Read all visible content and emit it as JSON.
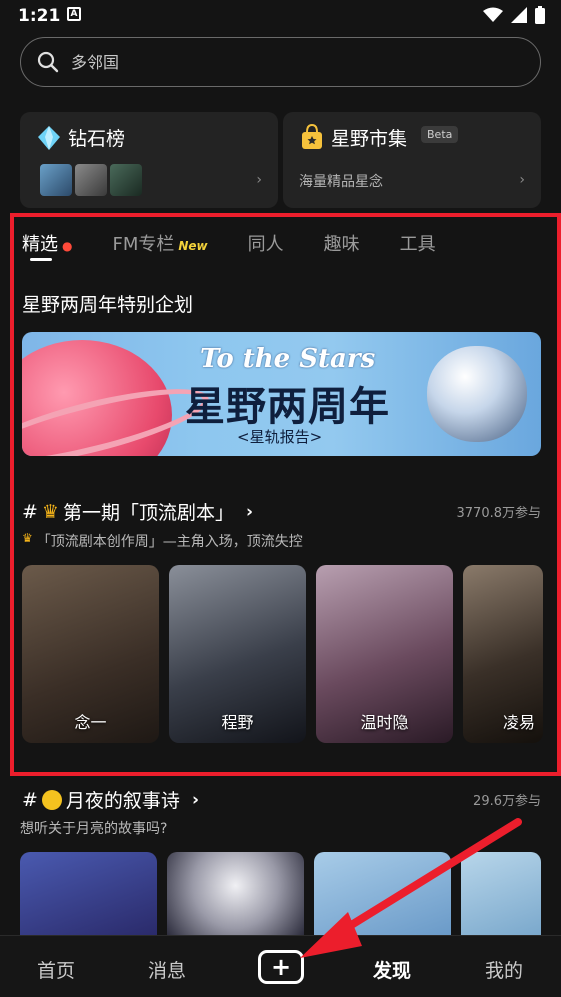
{
  "status": {
    "time": "1:21",
    "notif_icon": "A"
  },
  "search": {
    "placeholder": "多邻国"
  },
  "cards": [
    {
      "title": "钻石榜",
      "icon": "diamond-icon"
    },
    {
      "title": "星野市集",
      "badge": "Beta",
      "subtitle": "海量精品星念",
      "icon": "shopping-bag-icon"
    }
  ],
  "tabs": [
    {
      "label": "精选",
      "active": true
    },
    {
      "label": "FM专栏",
      "badge": "New"
    },
    {
      "label": "同人"
    },
    {
      "label": "趣味"
    },
    {
      "label": "工具"
    }
  ],
  "section": {
    "title": "星野两周年特别企划"
  },
  "banner": {
    "title_en": "To the Stars",
    "title_cn": "星野两周年",
    "subtitle": "<星轨报告>"
  },
  "topic1": {
    "hash": "#",
    "title": "第一期「顶流剧本」",
    "count": "3770.8万参与",
    "desc": "「顶流剧本创作周」—主角入场，顶流失控"
  },
  "characters": [
    {
      "name": "念一"
    },
    {
      "name": "程野"
    },
    {
      "name": "温时隐"
    },
    {
      "name": "凌易"
    }
  ],
  "topic2": {
    "hash": "#",
    "title": "月夜的叙事诗",
    "count": "29.6万参与",
    "desc": "想听关于月亮的故事吗?"
  },
  "nav": {
    "home": "首页",
    "messages": "消息",
    "create": "+",
    "discover": "发现",
    "mine": "我的"
  },
  "colors": {
    "highlight": "#ec1e2c",
    "background": "#141414",
    "new_badge": "#f3d23b"
  }
}
